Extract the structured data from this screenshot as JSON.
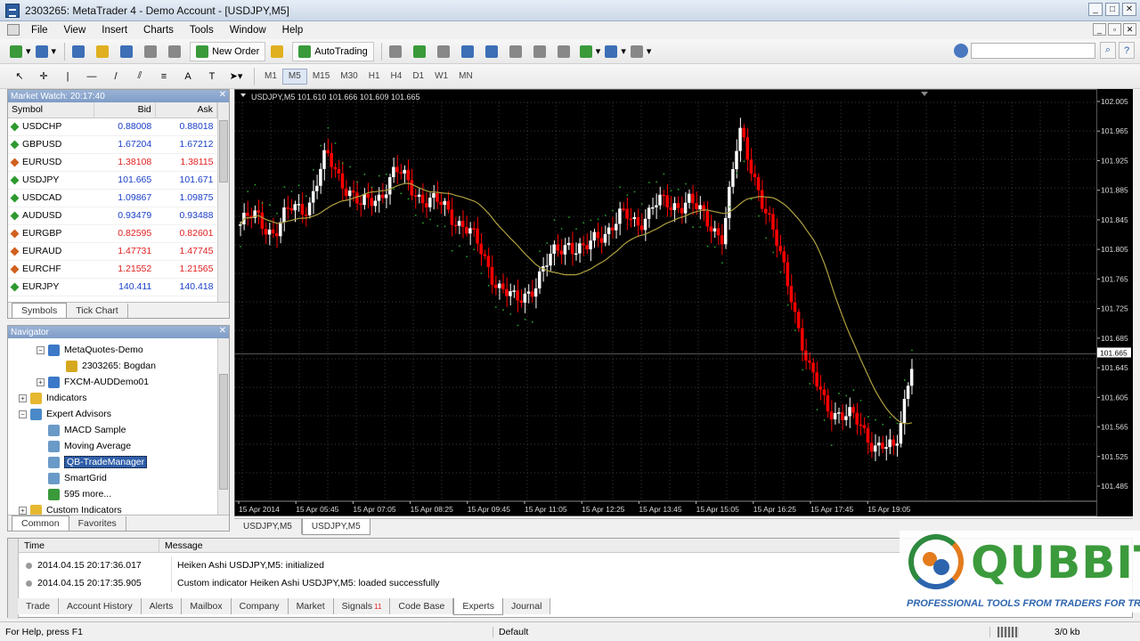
{
  "window": {
    "title": "2303265: MetaTrader 4 - Demo Account - [USDJPY,M5]"
  },
  "menu": [
    "File",
    "View",
    "Insert",
    "Charts",
    "Tools",
    "Window",
    "Help"
  ],
  "toolbar": {
    "new_order": "New Order",
    "autotrading": "AutoTrading",
    "timeframes": [
      "M1",
      "M5",
      "M15",
      "M30",
      "H1",
      "H4",
      "D1",
      "W1",
      "MN"
    ],
    "active_timeframe": "M5"
  },
  "market_watch": {
    "title": "Market Watch: 20:17:40",
    "columns": [
      "Symbol",
      "Bid",
      "Ask"
    ],
    "rows": [
      {
        "symbol": "USDCHP",
        "bid": "0.88008",
        "ask": "0.88018",
        "dir": "up"
      },
      {
        "symbol": "GBPUSD",
        "bid": "1.67204",
        "ask": "1.67212",
        "dir": "up"
      },
      {
        "symbol": "EURUSD",
        "bid": "1.38108",
        "ask": "1.38115",
        "dir": "dn"
      },
      {
        "symbol": "USDJPY",
        "bid": "101.665",
        "ask": "101.671",
        "dir": "up"
      },
      {
        "symbol": "USDCAD",
        "bid": "1.09867",
        "ask": "1.09875",
        "dir": "up"
      },
      {
        "symbol": "AUDUSD",
        "bid": "0.93479",
        "ask": "0.93488",
        "dir": "up"
      },
      {
        "symbol": "EURGBP",
        "bid": "0.82595",
        "ask": "0.82601",
        "dir": "dn"
      },
      {
        "symbol": "EURAUD",
        "bid": "1.47731",
        "ask": "1.47745",
        "dir": "dn"
      },
      {
        "symbol": "EURCHF",
        "bid": "1.21552",
        "ask": "1.21565",
        "dir": "dn"
      },
      {
        "symbol": "EURJPY",
        "bid": "140.411",
        "ask": "140.418",
        "dir": "up"
      }
    ],
    "tabs": [
      "Symbols",
      "Tick Chart"
    ]
  },
  "navigator": {
    "title": "Navigator",
    "items": [
      {
        "label": "MetaQuotes-Demo",
        "level": 1,
        "icon": "server-icon"
      },
      {
        "label": "2303265: Bogdan",
        "level": 2,
        "icon": "account-icon"
      },
      {
        "label": "FXCM-AUDDemo01",
        "level": 1,
        "icon": "server-icon"
      },
      {
        "label": "Indicators",
        "level": 0,
        "icon": "indicator-folder-icon"
      },
      {
        "label": "Expert Advisors",
        "level": 0,
        "icon": "expert-folder-icon"
      },
      {
        "label": "MACD Sample",
        "level": 1,
        "icon": "expert-icon"
      },
      {
        "label": "Moving Average",
        "level": 1,
        "icon": "expert-icon"
      },
      {
        "label": "QB-TradeManager",
        "level": 1,
        "icon": "expert-icon",
        "selected": true
      },
      {
        "label": "SmartGrid",
        "level": 1,
        "icon": "expert-icon"
      },
      {
        "label": "595 more...",
        "level": 1,
        "icon": "globe-icon"
      },
      {
        "label": "Custom Indicators",
        "level": 0,
        "icon": "custom-indicator-icon"
      }
    ],
    "tabs": [
      "Common",
      "Favorites"
    ]
  },
  "chart": {
    "header": "USDJPY,M5  101.610 101.666 101.609 101.665",
    "price_labels": [
      "102.005",
      "101.965",
      "101.925",
      "101.885",
      "101.845",
      "101.805",
      "101.765",
      "101.725",
      "101.685",
      "101.645",
      "101.605",
      "101.565",
      "101.525",
      "101.485"
    ],
    "current_price": "101.665",
    "time_labels": [
      "15 Apr 2014",
      "15 Apr 05:45",
      "15 Apr 07:05",
      "15 Apr 08:25",
      "15 Apr 09:45",
      "15 Apr 11:05",
      "15 Apr 12:25",
      "15 Apr 13:45",
      "15 Apr 15:05",
      "15 Apr 16:25",
      "15 Apr 17:45",
      "15 Apr 19:05"
    ],
    "tabs": [
      "USDJPY,M5",
      "USDJPY,M5"
    ],
    "colors": {
      "bull": "#ffffff",
      "bear": "#ff0000",
      "ma": "#b0a040",
      "sar": "#2aa52a",
      "grid": "#3a3a3a"
    }
  },
  "terminal": {
    "columns": [
      "Time",
      "Message"
    ],
    "rows": [
      {
        "time": "2014.04.15 20:17:36.017",
        "message": "Heiken Ashi USDJPY,M5: initialized"
      },
      {
        "time": "2014.04.15 20:17:35.905",
        "message": "Custom indicator Heiken Ashi USDJPY,M5: loaded successfully"
      }
    ],
    "tabs": [
      "Trade",
      "Account History",
      "Alerts",
      "Mailbox",
      "Company",
      "Market",
      "Signals",
      "Code Base",
      "Experts",
      "Journal"
    ],
    "signals_badge": "11",
    "active_tab": "Experts"
  },
  "status": {
    "help": "For Help, press F1",
    "profile": "Default",
    "traffic": "3/0 kb"
  },
  "brand": {
    "name": "QUBBIT",
    "tagline": "PROFESSIONAL TOOLS FROM TRADERS FOR TRADERS"
  }
}
